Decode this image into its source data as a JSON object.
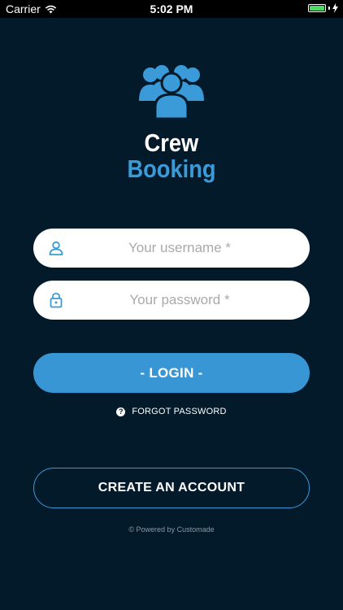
{
  "status_bar": {
    "carrier": "Carrier",
    "time": "5:02 PM",
    "battery_level": 1.0,
    "battery_color": "#4cd964"
  },
  "brand": {
    "icon": "crew-group-icon",
    "line1": "Crew",
    "line2": "Booking",
    "accent_color": "#3a9bd8"
  },
  "login_form": {
    "username_placeholder": "Your username *",
    "username_icon": "user-icon",
    "password_placeholder": "Your password *",
    "password_icon": "lock-icon",
    "login_label": "- LOGIN -",
    "login_color": "#3996d4",
    "forgot_icon": "question-icon",
    "forgot_label": "FORGOT PASSWORD"
  },
  "create_account_label": "CREATE AN ACCOUNT",
  "footer": "© Powered by Customade",
  "background_color": "#031a2b"
}
